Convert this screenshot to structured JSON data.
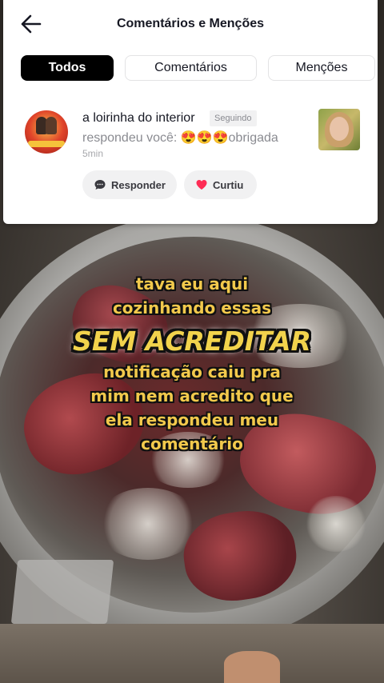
{
  "header": {
    "title": "Comentários e Menções"
  },
  "tabs": [
    {
      "label": "Todos",
      "active": true
    },
    {
      "label": "Comentários",
      "active": false
    },
    {
      "label": "Menções",
      "active": false
    }
  ],
  "notification": {
    "user_name": "a loirinha do interior",
    "follow_badge": "Seguindo",
    "message": "respondeu você: 😍😍😍obrigada",
    "time": "5min",
    "actions": {
      "reply_label": "Responder",
      "like_label": "Curtiu"
    }
  },
  "caption": {
    "line1": "tava eu aqui",
    "line2": "cozinhando essas",
    "banner": "SEM ACREDITAR",
    "line3": "notificação caiu pra",
    "line4": "mim nem acredito que",
    "line5": "ela respondeu meu",
    "line6": "comentário"
  },
  "colors": {
    "accent_active_tab": "#000000",
    "like_heart": "#fe2c55",
    "caption_text": "#f2c94c"
  },
  "icons": [
    "back-arrow-icon",
    "chat-bubble-icon",
    "heart-icon"
  ]
}
